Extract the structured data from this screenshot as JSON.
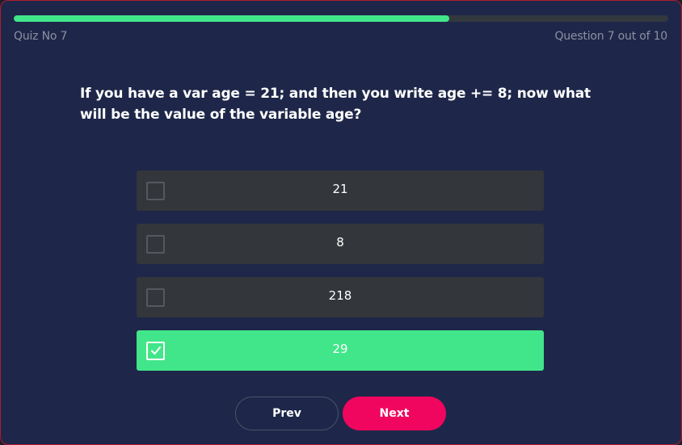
{
  "header": {
    "quiz_label": "Quiz No 7",
    "counter_label": "Question 7 out of 10",
    "progress": {
      "current": 7,
      "total": 10,
      "fraction": 0.666
    }
  },
  "question": {
    "text": "If you have a var age = 21; and then you write age += 8; now what will be the value of the variable age?"
  },
  "options": [
    {
      "label": "21",
      "selected": false
    },
    {
      "label": "8",
      "selected": false
    },
    {
      "label": "218",
      "selected": false
    },
    {
      "label": "29",
      "selected": true
    }
  ],
  "buttons": {
    "prev_label": "Prev",
    "next_label": "Next"
  },
  "colors": {
    "accent_green": "#42e68a",
    "next_button": "#f0065f",
    "background": "#1e2749",
    "option_bg": "#33363a"
  },
  "icons": {
    "checkbox_checked": "check-icon"
  }
}
